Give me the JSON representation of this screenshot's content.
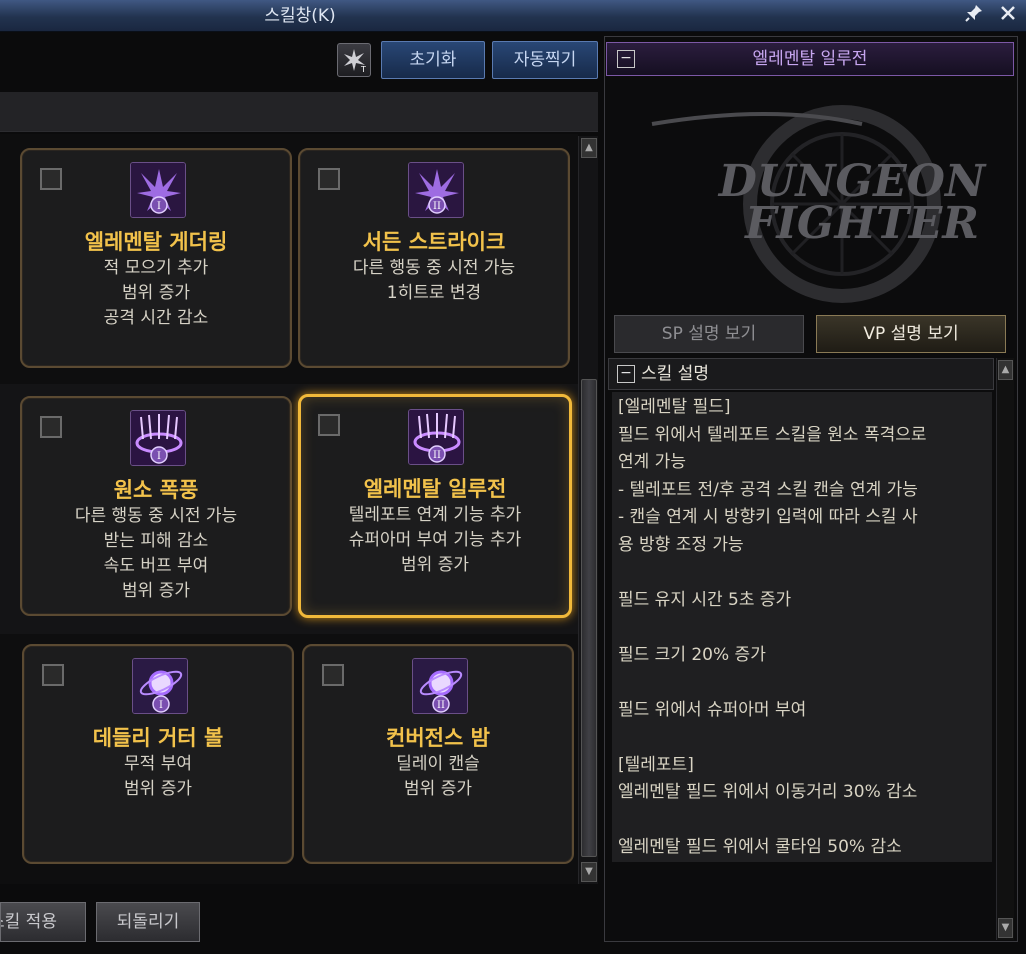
{
  "window": {
    "title": "스킬창(K)",
    "pin_glyph": "📌",
    "close_glyph": "✕"
  },
  "toolbar": {
    "reset_label": "초기화",
    "auto_label": "자동찍기"
  },
  "skills": [
    {
      "name": "엘레멘탈 게더링",
      "lines": [
        "적 모으기 추가",
        "범위 증가",
        "공격 시간 감소"
      ],
      "tier": "I",
      "icon": "purple-burst-icon",
      "selected": false
    },
    {
      "name": "서든 스트라이크",
      "lines": [
        "다른 행동 중 시전 가능",
        "1히트로 변경"
      ],
      "tier": "II",
      "icon": "purple-burst-icon",
      "selected": false
    },
    {
      "name": "원소 폭풍",
      "lines": [
        "다른 행동 중 시전 가능",
        "받는 피해 감소",
        "속도 버프 부여",
        "범위 증가"
      ],
      "tier": "I",
      "icon": "purple-storm-icon",
      "selected": false
    },
    {
      "name": "엘레멘탈 일루전",
      "lines": [
        "텔레포트 연계 기능 추가",
        "슈퍼아머 부여 기능 추가",
        "범위 증가"
      ],
      "tier": "II",
      "icon": "purple-storm-icon",
      "selected": true
    },
    {
      "name": "데들리 거터 볼",
      "lines": [
        "무적 부여",
        "범위 증가"
      ],
      "tier": "I",
      "icon": "purple-orb-icon",
      "selected": false
    },
    {
      "name": "컨버전스 밤",
      "lines": [
        "딜레이 캔슬",
        "범위 증가"
      ],
      "tier": "II",
      "icon": "purple-orb-icon",
      "selected": false
    }
  ],
  "bottom": {
    "apply_label": "스킬 적용",
    "revert_label": "되돌리기"
  },
  "detail": {
    "header": "엘레멘탈 일루전",
    "logo_line1": "DUNGEON",
    "logo_line2": "FIGHTER",
    "tab_sp": "SP 설명 보기",
    "tab_vp": "VP 설명 보기",
    "desc_header": "스킬 설명",
    "desc_lines": [
      "[엘레멘탈 필드]",
      "필드 위에서 텔레포트 스킬을 원소 폭격으로",
      "연계 가능",
      " - 텔레포트 전/후 공격 스킬 캔슬 연계 가능",
      " - 캔슬 연계 시 방향키 입력에 따라 스킬 사",
      "용 방향 조정 가능",
      "",
      "필드 유지 시간 5초 증가",
      "",
      "필드 크기 20% 증가",
      "",
      "필드 위에서 슈퍼아머 부여",
      "",
      "[텔레포트]",
      "엘레멘탈 필드 위에서 이동거리 30% 감소",
      "",
      "엘레멘탈 필드 위에서 쿨타임 50% 감소"
    ]
  },
  "colors": {
    "accent_gold": "#f2c24b",
    "purple": "#c7a6f0",
    "title_blue": "#2b3f63"
  }
}
